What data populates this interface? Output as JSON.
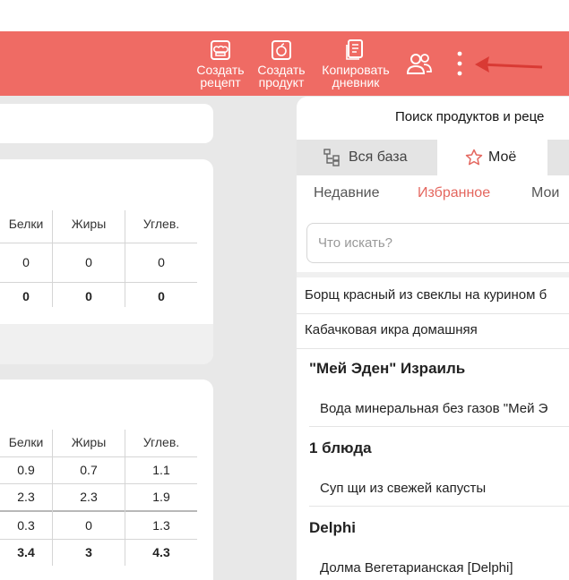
{
  "toolbar": {
    "create_recipe": [
      "Создать",
      "рецепт"
    ],
    "create_product": [
      "Создать",
      "продукт"
    ],
    "copy_diary": [
      "Копировать",
      "дневник"
    ],
    "accent": "#ef6b64"
  },
  "table1": {
    "headers": [
      "Белки",
      "Жиры",
      "Углев."
    ],
    "rows": [
      [
        "0",
        "0",
        "0"
      ]
    ],
    "total": [
      "0",
      "0",
      "0"
    ]
  },
  "table2": {
    "headers": [
      "Белки",
      "Жиры",
      "Углев."
    ],
    "rows": [
      [
        "0.9",
        "0.7",
        "1.1"
      ],
      [
        "2.3",
        "2.3",
        "1.9"
      ],
      [
        "0.3",
        "0",
        "1.3"
      ]
    ],
    "total": [
      "3.4",
      "3",
      "4.3"
    ]
  },
  "search": {
    "title": "Поиск продуктов и реце",
    "tabs": [
      "Вся база",
      "Моё"
    ],
    "subtabs": [
      "Недавние",
      "Избранное",
      "Мои"
    ],
    "placeholder": "Что искать?",
    "items": {
      "i1": "Борщ красный из свеклы на куринoм б",
      "i2": "Кабачковая икра домашняя",
      "g1": "\"Мей Эден\" Израиль",
      "i3": "Вода минеральная без газов \"Мей Э",
      "g2": "1 блюда",
      "i4": "Суп щи из свежей капусты",
      "g3": "Delphi",
      "i5": "Долма Вегетарианская [Delphi]"
    },
    "accent": "#e4675f"
  }
}
